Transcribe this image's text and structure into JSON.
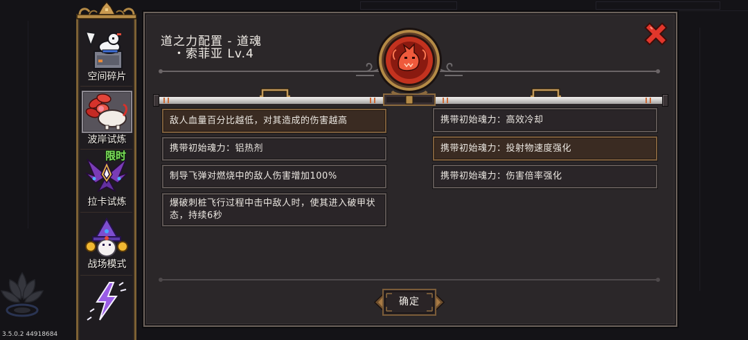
{
  "screen": {
    "version": "3.5.0.2 44918684",
    "corner_emblem_icon": "lotus-emblem-icon"
  },
  "sidebar": {
    "items": [
      {
        "label": "空间碎片",
        "icon": "space-fragment-icon",
        "selected": false
      },
      {
        "label": "波岸试炼",
        "icon": "flower-creature-icon",
        "selected": true
      },
      {
        "label": "拉卡试炼",
        "icon": "winged-crest-icon",
        "selected": false,
        "badge": "限时"
      },
      {
        "label": "战场模式",
        "icon": "wizard-icon",
        "selected": false
      },
      {
        "icon": "lightning-icon",
        "selected": false
      }
    ]
  },
  "dialog": {
    "title": "道之力配置 - 道魂",
    "subtitle": "・索菲亚 Lv.4",
    "emblem_icon": "red-beast-emblem-icon",
    "close_icon": "close-icon",
    "left_list": [
      {
        "text": "敌人血量百分比越低，对其造成的伤害越高",
        "highlighted": true
      },
      {
        "text": "携带初始魂力：铝热剂",
        "highlighted": false
      },
      {
        "text": "制导飞弹对燃烧中的敌人伤害增加100%",
        "highlighted": false
      },
      {
        "text": "爆破刺桩飞行过程中击中敌人时，使其进入破甲状态，持续6秒",
        "highlighted": false
      }
    ],
    "right_list": [
      {
        "text": "携带初始魂力：高效冷却",
        "highlighted": false
      },
      {
        "text": "携带初始魂力：投射物速度强化",
        "highlighted": true
      },
      {
        "text": "携带初始魂力：伤害倍率强化",
        "highlighted": false
      }
    ],
    "confirm_button": {
      "label": "确定"
    }
  },
  "colors": {
    "panel_bg": "#2b2729",
    "highlight_bg": "#3a2b22",
    "highlight_border": "#7e5f3c",
    "close_red": "#e2362b",
    "badge_green": "#7ee05c",
    "gold": "#b48a46"
  }
}
